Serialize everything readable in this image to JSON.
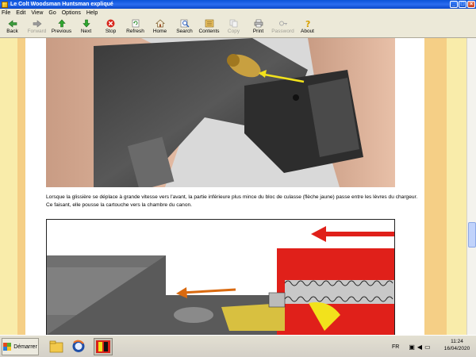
{
  "window": {
    "title": "Le Colt Woodsman Huntsman expliqué"
  },
  "menu": [
    "File",
    "Edit",
    "View",
    "Go",
    "Options",
    "Help"
  ],
  "toolbar": [
    {
      "label": "Back",
      "icon": "back-arrow-icon",
      "enabled": true
    },
    {
      "label": "Forward",
      "icon": "forward-arrow-icon",
      "enabled": false
    },
    {
      "label": "Previous",
      "icon": "up-arrow-icon",
      "enabled": true
    },
    {
      "label": "Next",
      "icon": "down-arrow-icon",
      "enabled": true
    },
    {
      "label": "Stop",
      "icon": "stop-icon",
      "enabled": true
    },
    {
      "label": "Refresh",
      "icon": "refresh-icon",
      "enabled": true
    },
    {
      "label": "Home",
      "icon": "home-icon",
      "enabled": true
    },
    {
      "label": "Search",
      "icon": "search-icon",
      "enabled": true
    },
    {
      "label": "Contents",
      "icon": "contents-icon",
      "enabled": true
    },
    {
      "label": "Copy",
      "icon": "copy-icon",
      "enabled": false
    },
    {
      "label": "Print",
      "icon": "print-icon",
      "enabled": true
    },
    {
      "label": "Password",
      "icon": "password-icon",
      "enabled": false
    },
    {
      "label": "About",
      "icon": "about-icon",
      "enabled": true
    }
  ],
  "content": {
    "caption": "Lorsque la glissière se déplace à grande vitesse vers l'avant, la partie inférieure plus mince du bloc de culasse (flèche jaune) passe entre les lèvres du chargeur. Ce faisant, elle pousse la cartouche vers la chambre du canon."
  },
  "taskbar": {
    "start_label": "Démarrer",
    "language": "FR",
    "time": "11:24",
    "date": "16/04/2020"
  },
  "colors": {
    "page_bg": "#f9ecaa",
    "stripe": "#f5cf86",
    "arrow_red": "#e0201a",
    "arrow_orange": "#d96a10",
    "arrow_yellow": "#f2e21c"
  }
}
